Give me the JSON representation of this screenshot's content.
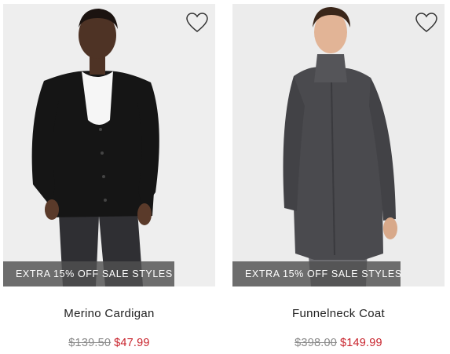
{
  "colors": {
    "sale_price": "#c8232c",
    "original_price": "#8a8a8a",
    "promo_bg": "#505050",
    "photo_bg": "#ededed"
  },
  "products": [
    {
      "name": "Merino Cardigan",
      "promo": "EXTRA 15% OFF SALE STYLES",
      "original_price": "$139.50",
      "sale_price": "$47.99",
      "favorite_icon": "heart-outline-icon"
    },
    {
      "name": "Funnelneck Coat",
      "promo": "EXTRA 15% OFF SALE STYLES",
      "original_price": "$398.00",
      "sale_price": "$149.99",
      "favorite_icon": "heart-outline-icon"
    }
  ]
}
